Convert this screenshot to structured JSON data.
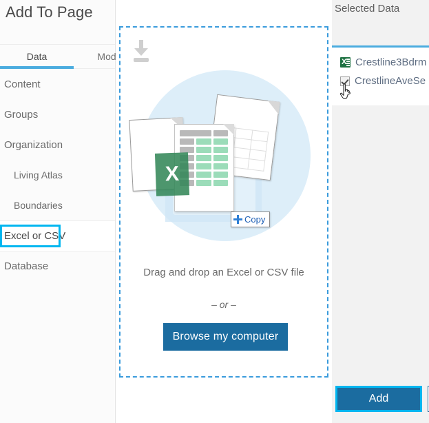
{
  "window": {
    "title": "Add To Page"
  },
  "tabs": [
    {
      "label": "Data",
      "active": true
    },
    {
      "label": "Model",
      "active": false
    }
  ],
  "sidebar": {
    "items": [
      {
        "label": "Content"
      },
      {
        "label": "Groups"
      },
      {
        "label": "Organization"
      },
      {
        "label": "Living Atlas"
      },
      {
        "label": "Boundaries"
      },
      {
        "label": "Excel or CSV"
      },
      {
        "label": "Database"
      }
    ],
    "focused_item": "Excel or CSV"
  },
  "dropzone": {
    "import_icon": "download-icon",
    "illustration": {
      "excel_letter": "X",
      "copy_badge_label": "Copy",
      "copy_badge_icon": "plus-icon"
    },
    "instruction": "Drag and drop an Excel or CSV file",
    "or_label": "– or –",
    "browse_button": "Browse my computer"
  },
  "selected_data": {
    "title": "Selected Data",
    "items": [
      {
        "label": "Crestline3Bdrm",
        "icon": "excel-file-icon",
        "checked": false
      },
      {
        "label": "CrestlineAveSe",
        "icon": "checkbox-icon",
        "checked": true
      }
    ]
  },
  "footer": {
    "add_label": "Add"
  },
  "colors": {
    "accent_blue": "#4bacdf",
    "focus_cyan": "#00b6f0",
    "button_blue": "#1b6ca0",
    "dash_blue": "#3a9bdc",
    "excel_green": "#1f7243",
    "circle_blue": "#ddeef9"
  },
  "cursor": {
    "type": "pointer-hand-cursor"
  }
}
